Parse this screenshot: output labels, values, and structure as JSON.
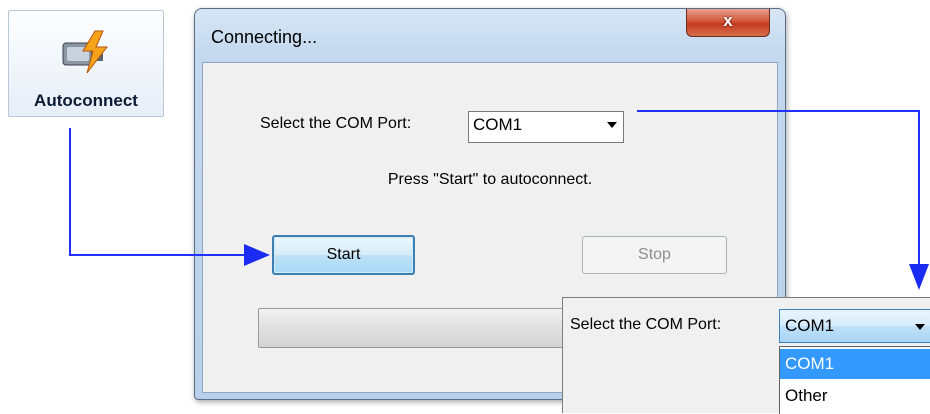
{
  "toolbar": {
    "autoconnect_label": "Autoconnect",
    "icon": "network-plug-bolt-icon"
  },
  "dialog": {
    "title": "Connecting...",
    "close_label": "x",
    "com_port_label": "Select the COM Port:",
    "com_port_value": "COM1",
    "hint_text": "Press \"Start\" to autoconnect.",
    "start_label": "Start",
    "stop_label": "Stop",
    "progress": 0
  },
  "callout": {
    "com_port_label": "Select the COM Port:",
    "com_port_value": "COM1",
    "options": [
      "COM1",
      "Other"
    ],
    "selected_option": "COM1"
  },
  "colors": {
    "arrow": "#1a2cf2",
    "selection": "#3399ff",
    "close_button": "#c23a1c"
  }
}
